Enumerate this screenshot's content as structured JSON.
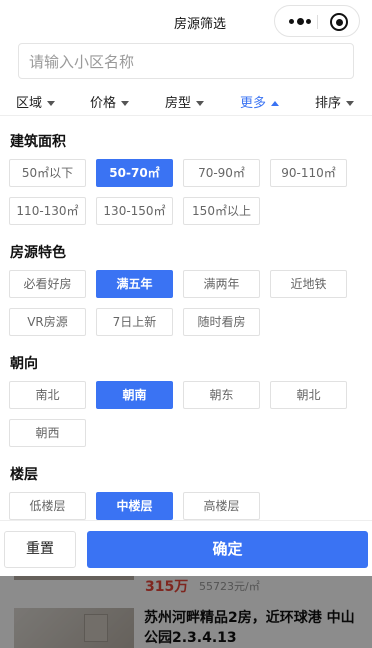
{
  "navbar": {
    "title": "房源筛选"
  },
  "search": {
    "placeholder": "请输入小区名称"
  },
  "filter_tabs": [
    {
      "label": "区域",
      "active": false
    },
    {
      "label": "价格",
      "active": false
    },
    {
      "label": "房型",
      "active": false
    },
    {
      "label": "更多",
      "active": true
    },
    {
      "label": "排序",
      "active": false
    }
  ],
  "sections": {
    "area": {
      "title": "建筑面积",
      "options": [
        "50㎡以下",
        "50-70㎡",
        "70-90㎡",
        "90-110㎡",
        "110-130㎡",
        "130-150㎡",
        "150㎡以上"
      ],
      "selected": "50-70㎡"
    },
    "features": {
      "title": "房源特色",
      "options": [
        "必看好房",
        "满五年",
        "满两年",
        "近地铁",
        "VR房源",
        "7日上新",
        "随时看房"
      ],
      "selected": "满五年"
    },
    "orientation": {
      "title": "朝向",
      "options": [
        "南北",
        "朝南",
        "朝东",
        "朝北",
        "朝西"
      ],
      "selected": "朝南"
    },
    "floor": {
      "title": "楼层",
      "options": [
        "低楼层",
        "中楼层",
        "高楼层"
      ],
      "selected": "中楼层"
    }
  },
  "actions": {
    "reset_label": "重置",
    "confirm_label": "确定"
  },
  "background_listing": {
    "price": "315万",
    "unit_price": "55723元/㎡",
    "title": "苏州河畔精品2房，近环球港 中山公园2.3.4.13"
  },
  "colors": {
    "accent": "#3a73f3",
    "price": "#e8463a"
  },
  "icons": [
    "more-dots-icon",
    "close-circle-icon",
    "caret-down-icon",
    "caret-up-icon"
  ]
}
